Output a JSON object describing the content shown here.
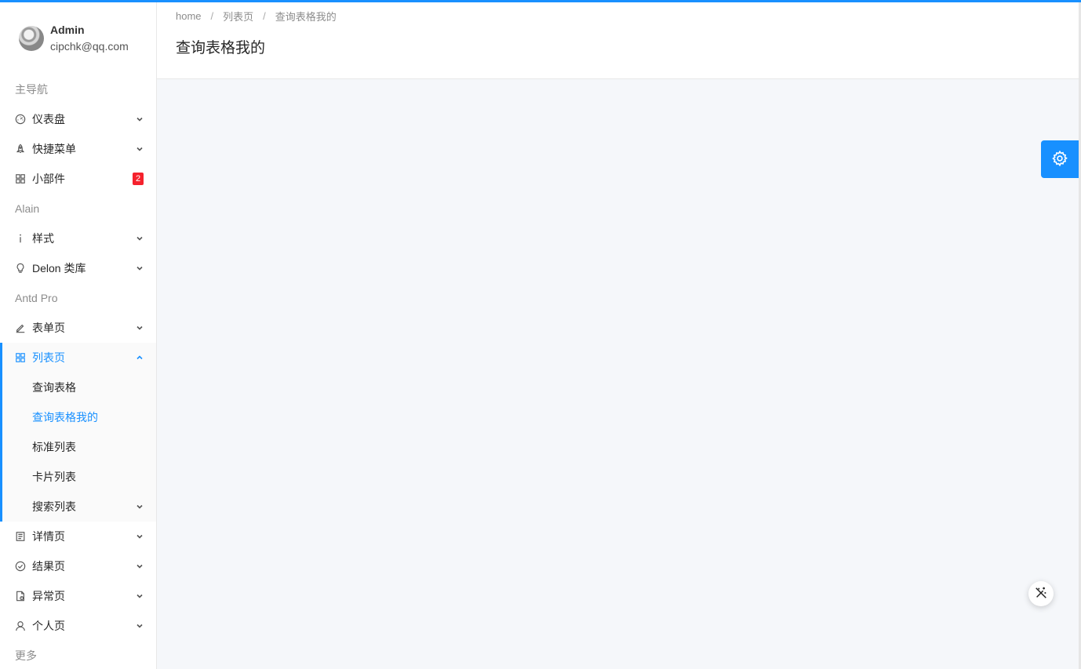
{
  "user": {
    "name": "Admin",
    "email": "cipchk@qq.com"
  },
  "nav": {
    "group_main": "主导航",
    "dashboard": "仪表盘",
    "shortcut": "快捷菜单",
    "widgets": "小部件",
    "widgets_badge": "2",
    "group_alain": "Alain",
    "style": "样式",
    "delon": "Delon 类库",
    "group_antd": "Antd Pro",
    "form": "表单页",
    "list": "列表页",
    "list_children": {
      "query_table": "查询表格",
      "query_table_mine": "查询表格我的",
      "standard_list": "标准列表",
      "card_list": "卡片列表",
      "search_list": "搜索列表"
    },
    "detail": "详情页",
    "result": "结果页",
    "exception": "异常页",
    "profile": "个人页",
    "group_more": "更多"
  },
  "breadcrumb": {
    "home": "home",
    "sep": "/",
    "level1": "列表页",
    "level2": "查询表格我的"
  },
  "page_title": "查询表格我的",
  "colors": {
    "primary": "#1890ff",
    "badge": "#f5222d",
    "content_bg": "#f5f7fa"
  }
}
